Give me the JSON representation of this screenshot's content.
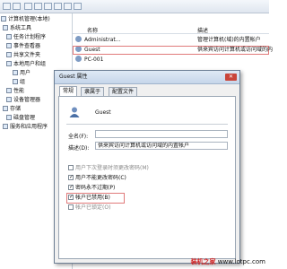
{
  "tree": {
    "root": "计算机管理(本地)",
    "items": [
      "系统工具",
      "任务计划程序",
      "事件查看器",
      "共享文件夹",
      "本地用户和组",
      "用户",
      "组",
      "性能",
      "设备管理器",
      "存储",
      "磁盘管理",
      "服务和应用程序"
    ]
  },
  "list": {
    "col_name": "名称",
    "col_desc": "描述",
    "rows": [
      {
        "name": "Administrat...",
        "desc": "管理计算机(域)的内置帐户"
      },
      {
        "name": "Guest",
        "desc": "供来宾访问计算机或访问域的内"
      },
      {
        "name": "PC-001",
        "desc": ""
      }
    ]
  },
  "dialog": {
    "title": "Guest 属性",
    "close": "✕",
    "tabs": [
      "常规",
      "隶属于",
      "配置文件"
    ],
    "username": "Guest",
    "fullname_label": "全名(F):",
    "fullname_value": "",
    "desc_label": "描述(D):",
    "desc_value": "供来宾访问计算机或访问域的内置帐户",
    "checks": [
      {
        "label": "用户下次登录时须更改密码(M)",
        "checked": false
      },
      {
        "label": "用户不能更改密码(C)",
        "checked": true
      },
      {
        "label": "密码永不过期(P)",
        "checked": true
      },
      {
        "label": "帐户已禁用(B)",
        "checked": true
      },
      {
        "label": "帐户已锁定(O)",
        "checked": false
      }
    ]
  },
  "watermark": {
    "text": "装机之家",
    "url": "www.lotpc.com"
  }
}
